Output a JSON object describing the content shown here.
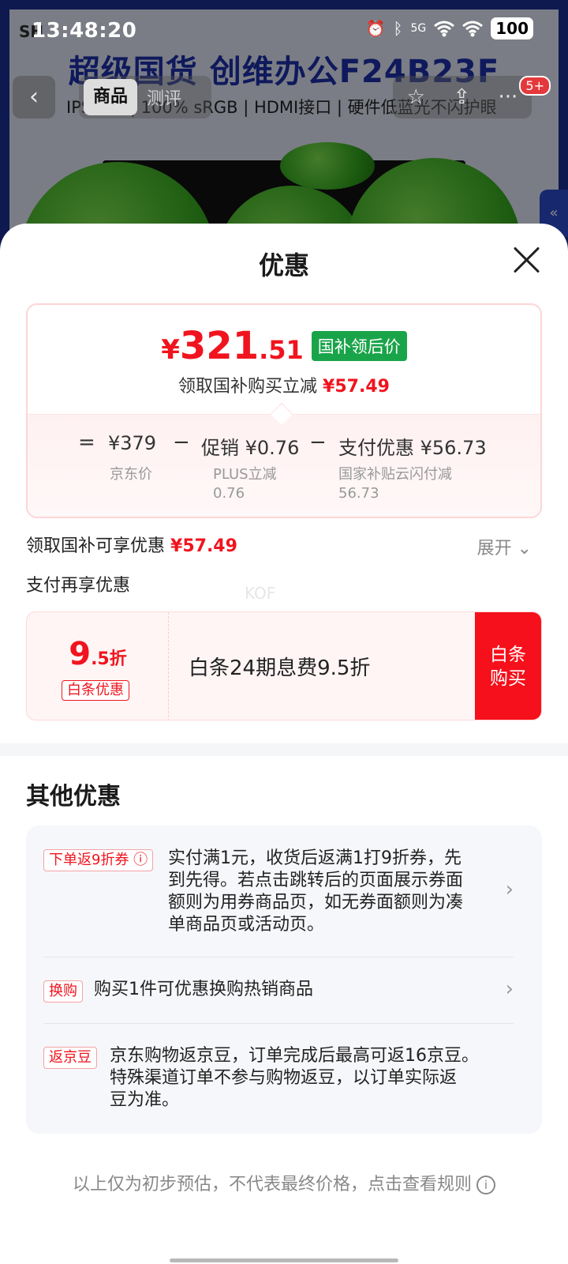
{
  "status_bar": {
    "time": "13:48:20",
    "carrier_hint": "SH",
    "network": "5G",
    "battery": "100"
  },
  "background": {
    "headline": "超级国货 创维办公F24B23F",
    "subline": "IPS面板 | 100% sRGB | HDMI接口 | 硬件低蓝光不闪护眼",
    "side_tab_icon": "«"
  },
  "nav": {
    "back_icon": "‹",
    "tabs": [
      "商品",
      "测评"
    ],
    "star_icon": "☆",
    "share_icon": "⇪",
    "more_icon": "···",
    "message_badge": "5+"
  },
  "sheet": {
    "title": "优惠",
    "price": {
      "currency": "¥",
      "integer": "321",
      "decimal": ".51",
      "tag": "国补领后价",
      "save_text": "领取国补购买立减",
      "save_amount": "¥57.49"
    },
    "breakdown": {
      "eq": "=",
      "jd_price": "¥379",
      "jd_price_label": "京东价",
      "minus1": "−",
      "promo": "促销 ¥0.76",
      "promo_label": "PLUS立减",
      "promo_value": "0.76",
      "minus2": "−",
      "pay": "支付优惠 ¥56.73",
      "pay_label": "国家补贴云闪付减",
      "pay_value": "56.73"
    },
    "subsidy_row": {
      "label": "领取国补可享优惠",
      "amount": "¥57.49",
      "expand": "展开 ⌄"
    },
    "pay_again": "支付再享优惠",
    "watermark": "KOF",
    "baitiao": {
      "rate_big": "9",
      "rate_small": ".5折",
      "label": "白条优惠",
      "text": "白条24期息费9.5折",
      "button_line1": "白条",
      "button_line2": "购买"
    },
    "other_title": "其他优惠",
    "offers": [
      {
        "tag": "下单返9折券 ⓘ",
        "lines": [
          "实付满1元，收货后返满1打9折券，先",
          "到先得。若点击跳转后的页面展示券面",
          "额则为用券商品页，如无券面额则为凑",
          "单商品页或活动页。"
        ]
      },
      {
        "tag": "换购",
        "lines": [
          "购买1件可优惠换购热销商品"
        ]
      },
      {
        "tag": "返京豆",
        "lines": [
          "京东购物返京豆，订单完成后最高可返16京豆。",
          "特殊渠道订单不参与购物返豆，以订单实际返",
          "豆为准。"
        ]
      }
    ],
    "arrow_icon": "›",
    "footer": "以上仅为初步预估，不代表最终价格，点击查看规则",
    "footer_info_icon": "i"
  }
}
